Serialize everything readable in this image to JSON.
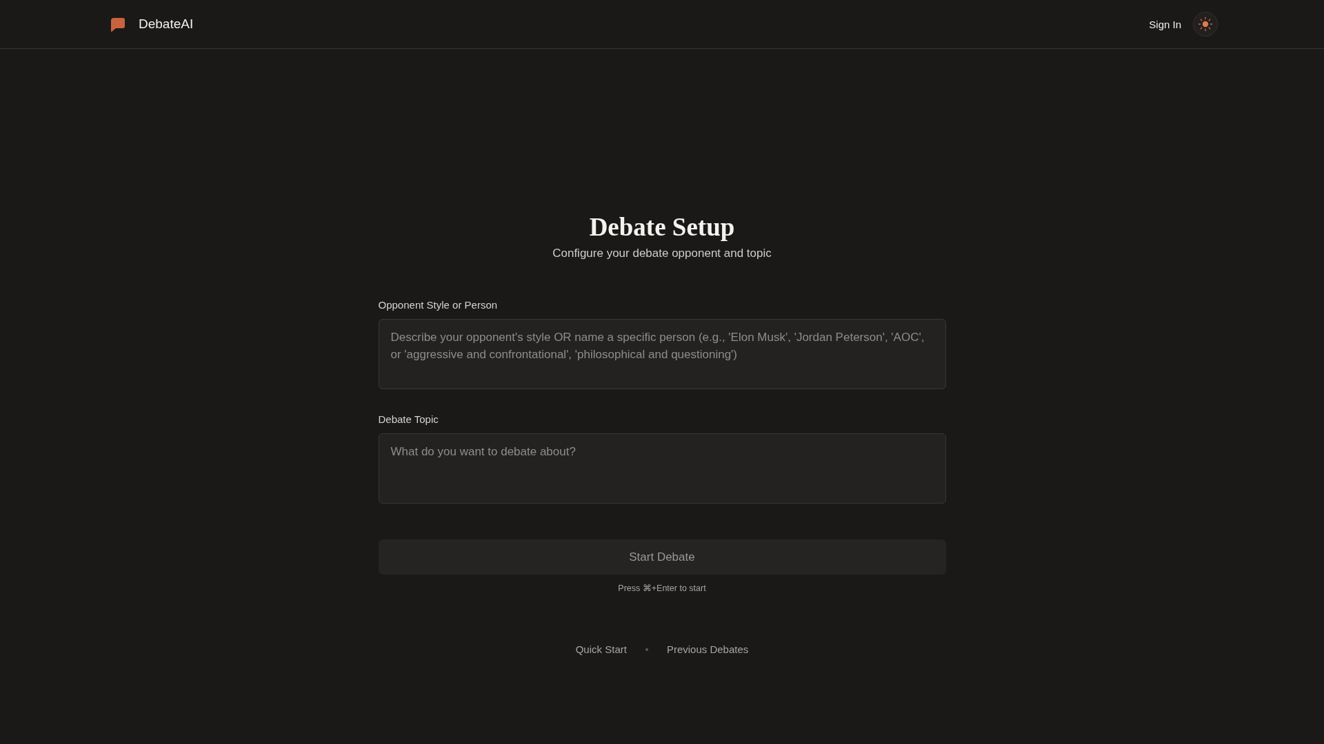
{
  "header": {
    "brand": "DebateAI",
    "sign_in": "Sign In"
  },
  "setup": {
    "title": "Debate Setup",
    "subtitle": "Configure your debate opponent and topic",
    "fields": [
      {
        "label": "Opponent Style or Person",
        "placeholder": "Describe your opponent's style OR name a specific person (e.g., 'Elon Musk', 'Jordan Peterson', 'AOC', or 'aggressive and confrontational', 'philosophical and questioning')"
      },
      {
        "label": "Debate Topic",
        "placeholder": "What do you want to debate about?"
      }
    ],
    "start_button": {
      "label": "Start Debate",
      "disabled": true
    },
    "hint": "Press ⌘+Enter to start"
  },
  "footer_links": [
    "Quick Start",
    "Previous Debates"
  ]
}
